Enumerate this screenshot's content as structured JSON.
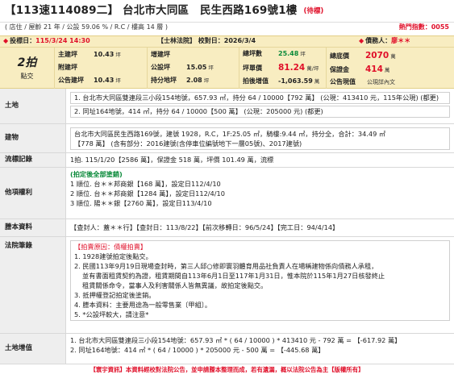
{
  "header": {
    "title": "【113速114089二】 台北市大同區　民生西路169號1樓",
    "status": "(待標)"
  },
  "subheader": {
    "left": "( 店住 / 屋齡 21 年 / 公設 59.06 % / R.C / 樓高 14 層 )",
    "hot_label": "熱門指數：",
    "hot_value": "0055"
  },
  "infobar": {
    "top": {
      "bid_label": "投標日：",
      "bid_value": "115/3/24 14:30",
      "court": "【士林法院】 校對日：2026/3/4",
      "debtor_label": "債務人：",
      "debtor_value": "廖＊＊"
    },
    "price_box": {
      "big": "2拍",
      "small": "點交"
    },
    "cols": [
      [
        {
          "label": "主建坪",
          "value": "10.43",
          "unit": "坪"
        },
        {
          "label": "附建坪",
          "value": "",
          "unit": ""
        },
        {
          "label": "公告建坪",
          "value": "10.43",
          "unit": "坪"
        }
      ],
      [
        {
          "label": "增建坪",
          "value": "",
          "unit": ""
        },
        {
          "label": "公設坪",
          "value": "15.05",
          "unit": "坪"
        },
        {
          "label": "持分地坪",
          "value": "2.08",
          "unit": "坪"
        }
      ],
      [
        {
          "label": "總坪數",
          "value": "25.48",
          "unit": "坪"
        },
        {
          "label": "坪單價",
          "value": "81.24",
          "unit": "萬/坪"
        },
        {
          "label": "拍後增值",
          "value": "-1,063.59",
          "unit": "萬"
        }
      ],
      [
        {
          "label": "總底價",
          "value": "2070",
          "unit": "萬"
        },
        {
          "label": "保證金",
          "value": "414",
          "unit": "萬"
        },
        {
          "label": "公告現值",
          "value": "",
          "unit": "公現詳內文"
        }
      ]
    ]
  },
  "sections": {
    "land": {
      "label": "土地",
      "line1": "1. 台北市大同區雙連段三小段154地號，657.93 ㎡，持分 64 / 10000【792 萬】 (公現：413410 元，115年公現) (都更)",
      "line2": "2. 同址164地號，414 ㎡，持分 64 / 10000【500 萬】 (公現：205000 元) (都更)"
    },
    "building": {
      "label": "建物",
      "line1": "台北市大同區民生西路169號，建號 1928，R.C，1F:25.05 ㎡，騎樓:9.44 ㎡，持分全，合計：34.49 ㎡",
      "line2": "【778 萬】 (含有部分：2016建號(含停車位編號地下一層05號)、2017建號)"
    },
    "history": {
      "label": "流標記錄",
      "line1": "1拍. 115/1/20【2586 萬】，保證金 518 萬，坪價 101.49 萬，流標"
    },
    "rights": {
      "label": "他項權利",
      "note": "(拍定後全部塗銷)",
      "items": [
        "1 順位. 台＊＊邦商銀【168 萬】，設定日112/4/10",
        "2 順位. 台＊＊邦商銀【1284 萬】，設定日112/4/10",
        "3 順位. 陽＊＊銀【2760 萬】，設定日113/4/10"
      ]
    },
    "seizure": {
      "label": "謄本資料",
      "text": "【查封人：蓋＊＊行】【查封日：113/8/22】【前次移轉日：96/5/24】【完工日：94/4/14】"
    },
    "court": {
      "label": "法院筆錄",
      "reason": "【拍賣原因：債權拍賣】",
      "items": [
        "1. 1928建號拍定後點交。",
        "2. 民國113年9月19日現場查封時，第三人邱○修即寰羽體育用品社負責人在場稱建物係向債務人承租，",
        "並有書面租賃契約為證，租賃期間自113年6月1日至117年1月31日，惟本院於115年1月27日核發終止",
        "租賃關係命令，當事人及利害關係人皆無異議，故拍定後點交。",
        "3. 抵押權登記拍定後塗銷。",
        "4. 謄本資料：主要用途為一般零售業〔甲組〕。",
        "5. *公設坪較大，請注意*"
      ]
    },
    "tax": {
      "label": "土地增值",
      "line1": "1. 台北市大同區雙連段三小段154地號：657.93 ㎡ * ( 64 / 10000 ) * 413410 元 - 792 萬 = 【-617.92 萬】",
      "line2": "2. 同址164地號：414 ㎡ * ( 64 / 10000 ) * 205000 元 - 500 萬 = 【-445.68 萬】"
    }
  },
  "footer": {
    "text": "【寰宇資訊】本資料經校對法院公告，並申請謄本整理而成，若有遺漏，概以法院公告為主【版權所有】"
  }
}
